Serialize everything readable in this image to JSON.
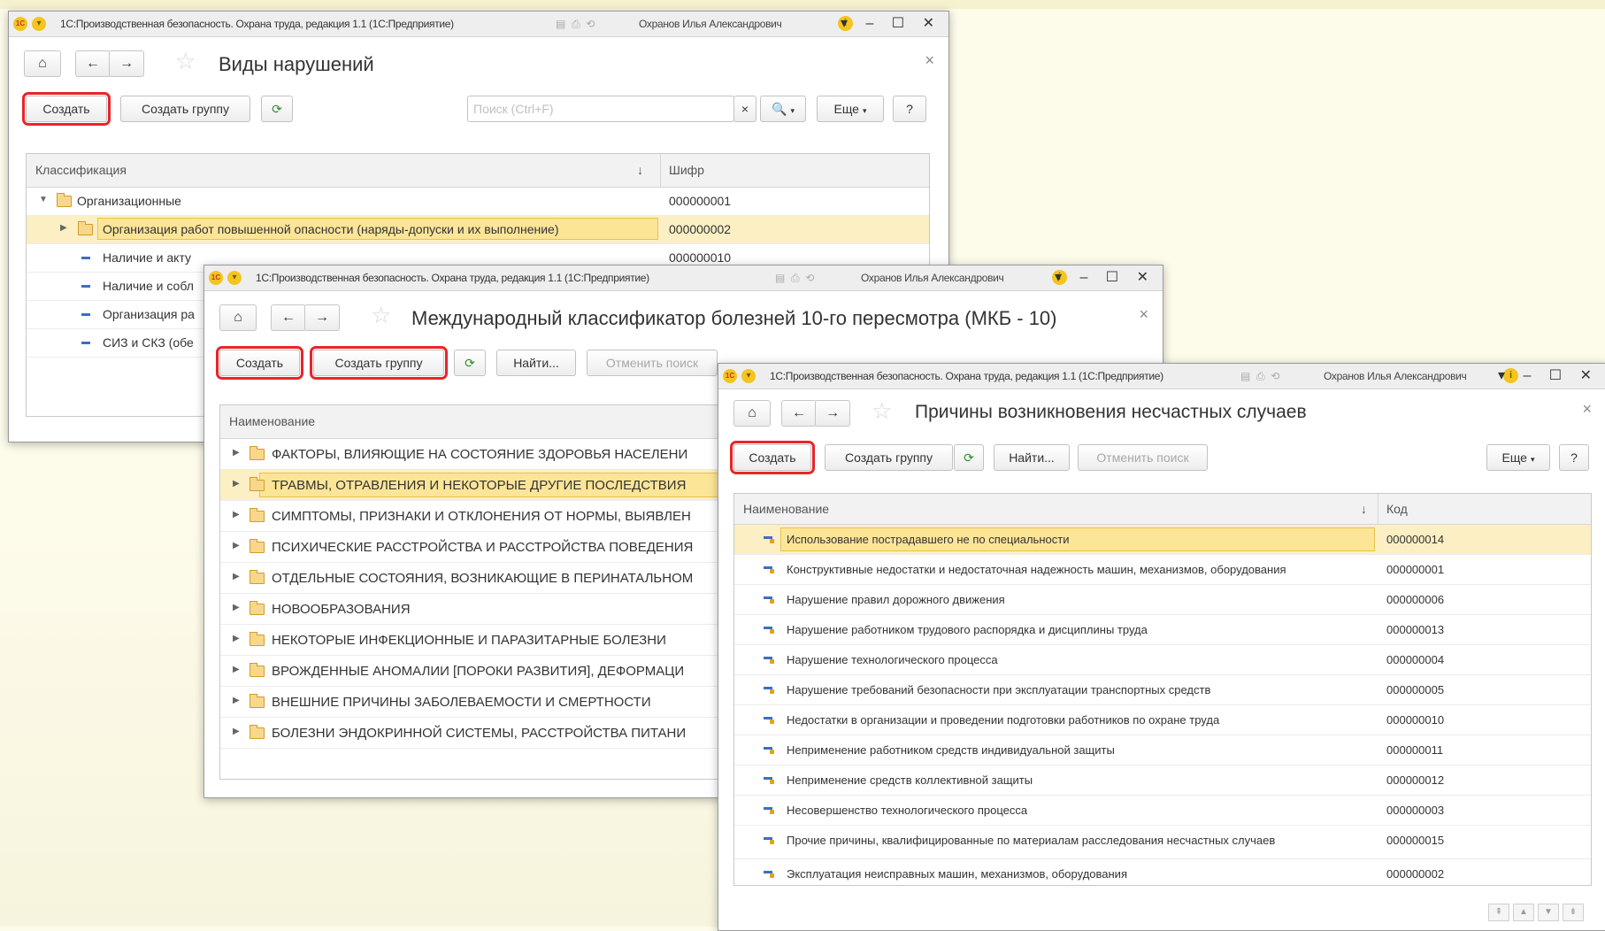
{
  "app_title": "1С:Производственная безопасность. Охрана труда, редакция 1.1  (1С:Предприятие)",
  "user": "Охранов Илья Александрович",
  "common": {
    "create": "Создать",
    "create_group": "Создать группу",
    "find": "Найти...",
    "cancel_search": "Отменить поиск",
    "more": "Еще",
    "help": "?"
  },
  "w1": {
    "title": "Виды нарушений",
    "search_placeholder": "Поиск (Ctrl+F)",
    "col1": "Классификация",
    "col2": "Шифр",
    "rows": [
      {
        "name": "Организационные",
        "code": "000000001"
      },
      {
        "name": "Организация работ повышенной опасности (наряды-допуски и их выполнение)",
        "code": "000000002"
      },
      {
        "name": "Наличие и акту",
        "code": "000000010"
      },
      {
        "name": "Наличие и собл",
        "code": ""
      },
      {
        "name": "Организация ра",
        "code": ""
      },
      {
        "name": "СИЗ и СКЗ (обе",
        "code": ""
      }
    ]
  },
  "w2": {
    "title": "Международный классификатор болезней 10-го пересмотра (МКБ - 10)",
    "col1": "Наименование",
    "rows": [
      "ФАКТОРЫ, ВЛИЯЮЩИЕ НА СОСТОЯНИЕ ЗДОРОВЬЯ НАСЕЛЕНИ",
      "ТРАВМЫ, ОТРАВЛЕНИЯ И НЕКОТОРЫЕ ДРУГИЕ ПОСЛЕДСТВИЯ",
      "СИМПТОМЫ, ПРИЗНАКИ И ОТКЛОНЕНИЯ ОТ НОРМЫ, ВЫЯВЛЕН",
      "ПСИХИЧЕСКИЕ РАССТРОЙСТВА И РАССТРОЙСТВА ПОВЕДЕНИЯ",
      "ОТДЕЛЬНЫЕ СОСТОЯНИЯ, ВОЗНИКАЮЩИЕ В ПЕРИНАТАЛЬНОМ",
      "НОВООБРАЗОВАНИЯ",
      "НЕКОТОРЫЕ ИНФЕКЦИОННЫЕ И ПАРАЗИТАРНЫЕ БОЛЕЗНИ",
      "ВРОЖДЕННЫЕ АНОМАЛИИ [ПОРОКИ РАЗВИТИЯ], ДЕФОРМАЦИ",
      "ВНЕШНИЕ ПРИЧИНЫ ЗАБОЛЕВАЕМОСТИ И СМЕРТНОСТИ",
      "БОЛЕЗНИ ЭНДОКРИННОЙ СИСТЕМЫ, РАССТРОЙСТВА ПИТАНИ"
    ]
  },
  "w3": {
    "title": "Причины возникновения несчастных случаев",
    "col1": "Наименование",
    "col2": "Код",
    "rows": [
      {
        "name": "Использование пострадавшего не по специальности",
        "code": "000000014"
      },
      {
        "name": "Конструктивные недостатки и недостаточная надежность машин, механизмов, оборудования",
        "code": "000000001"
      },
      {
        "name": "Нарушение правил дорожного движения",
        "code": "000000006"
      },
      {
        "name": "Нарушение работником трудового распорядка и дисциплины труда",
        "code": "000000013"
      },
      {
        "name": "Нарушение технологического процесса",
        "code": "000000004"
      },
      {
        "name": "Нарушение требований безопасности при эксплуатации транспортных средств",
        "code": "000000005"
      },
      {
        "name": "Недостатки в организации и проведении подготовки работников по охране труда",
        "code": "000000010"
      },
      {
        "name": "Неприменение работником средств индивидуальной защиты",
        "code": "000000011"
      },
      {
        "name": "Неприменение средств коллективной защиты",
        "code": "000000012"
      },
      {
        "name": "Несовершенство технологического процесса",
        "code": "000000003"
      },
      {
        "name": "Прочие причины, квалифицированные по материалам расследования несчастных случаев",
        "code": "000000015"
      },
      {
        "name": "Эксплуатация неисправных машин, механизмов, оборудования",
        "code": "000000002"
      }
    ]
  }
}
